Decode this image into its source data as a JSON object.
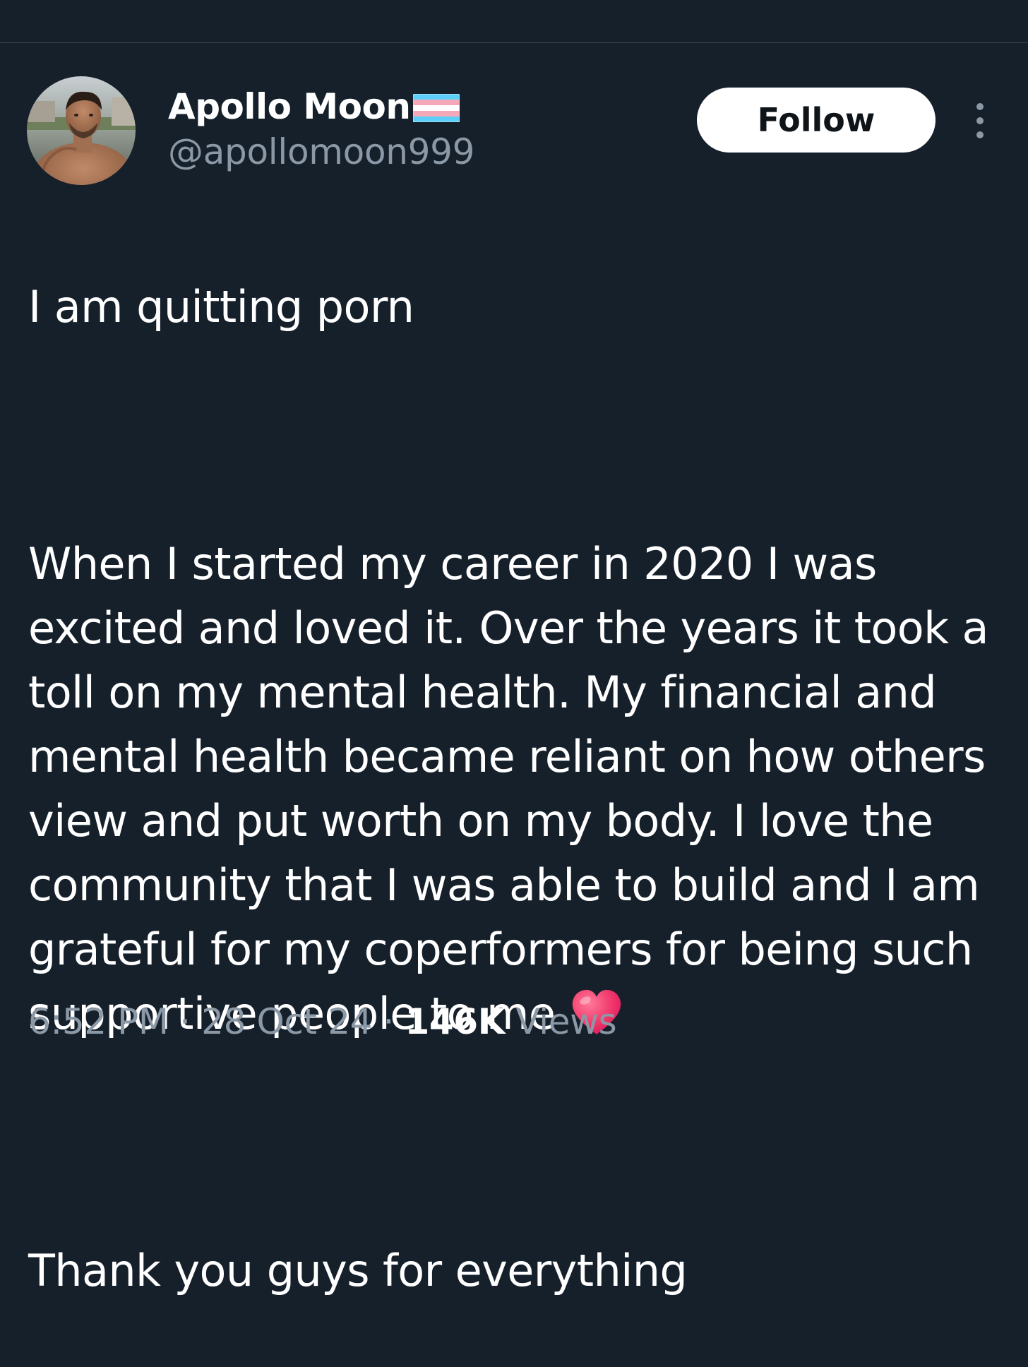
{
  "colors": {
    "background": "#15202b",
    "primary_text": "#ffffff",
    "secondary_text": "#8b98a5",
    "divider": "#38444d",
    "follow_button_bg": "#ffffff",
    "follow_button_text": "#0f1419"
  },
  "author": {
    "display_name": "Apollo Moon",
    "name_flag_icon": "transgender-flag-icon",
    "handle": "@apollomoon999",
    "avatar_icon": "profile-photo"
  },
  "actions": {
    "follow_label": "Follow",
    "more_icon": "more-vertical-icon"
  },
  "tweet": {
    "paragraph_1": "I am quitting porn",
    "paragraph_2": "When I started my career in 2020 I was excited and loved it. Over the years it took a toll on my mental health. My financial and mental health became reliant on how others view and put worth on my body. I love the community that I was able to build and I am grateful for my coperformers for being such supportive people to me",
    "paragraph_2_emoji": "heart-emoji",
    "paragraph_3": "Thank you guys for everything"
  },
  "meta": {
    "time": "6:52 PM",
    "separator": " · ",
    "date": "28 Oct 24",
    "views_count": "146K",
    "views_label": " Views"
  }
}
